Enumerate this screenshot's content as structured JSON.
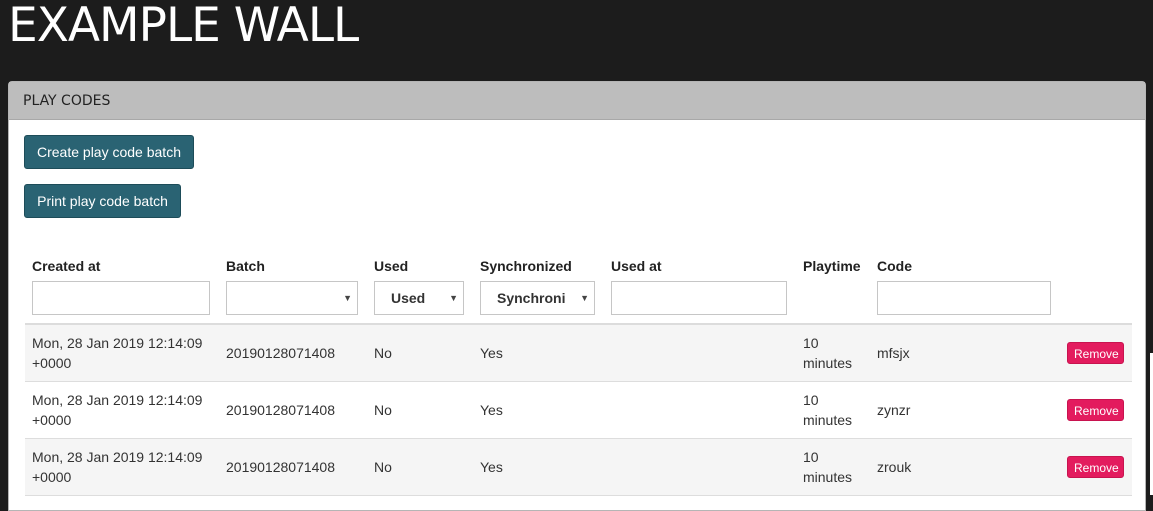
{
  "app": {
    "title": "EXAMPLE WALL"
  },
  "panel": {
    "title": "PLAY CODES",
    "create_button": "Create play code batch",
    "print_button": "Print play code batch"
  },
  "table": {
    "headers": {
      "created_at": "Created at",
      "batch": "Batch",
      "used": "Used",
      "synchronized": "Synchronized",
      "used_at": "Used at",
      "playtime": "Playtime",
      "code": "Code"
    },
    "filters": {
      "created_at": "",
      "batch": "",
      "used": "Used",
      "synchronized": "Synchroni",
      "used_at": "",
      "code": ""
    },
    "rows": [
      {
        "created_line1": "Mon, 28 Jan 2019 12:14:09",
        "created_line2": "+0000",
        "batch": "20190128071408",
        "used": "No",
        "synchronized": "Yes",
        "used_at": "",
        "playtime_value": "10",
        "playtime_unit": "minutes",
        "code": "mfsjx",
        "action": "Remove"
      },
      {
        "created_line1": "Mon, 28 Jan 2019 12:14:09",
        "created_line2": "+0000",
        "batch": "20190128071408",
        "used": "No",
        "synchronized": "Yes",
        "used_at": "",
        "playtime_value": "10",
        "playtime_unit": "minutes",
        "code": "zynzr",
        "action": "Remove"
      },
      {
        "created_line1": "Mon, 28 Jan 2019 12:14:09",
        "created_line2": "+0000",
        "batch": "20190128071408",
        "used": "No",
        "synchronized": "Yes",
        "used_at": "",
        "playtime_value": "10",
        "playtime_unit": "minutes",
        "code": "zrouk",
        "action": "Remove"
      }
    ]
  },
  "icons": {
    "dropdown": "caret-down-icon"
  },
  "colors": {
    "background": "#1c1c1c",
    "panel_heading": "#bdbdbd",
    "primary_button": "#2a6373",
    "danger_button": "#e31b5e"
  }
}
